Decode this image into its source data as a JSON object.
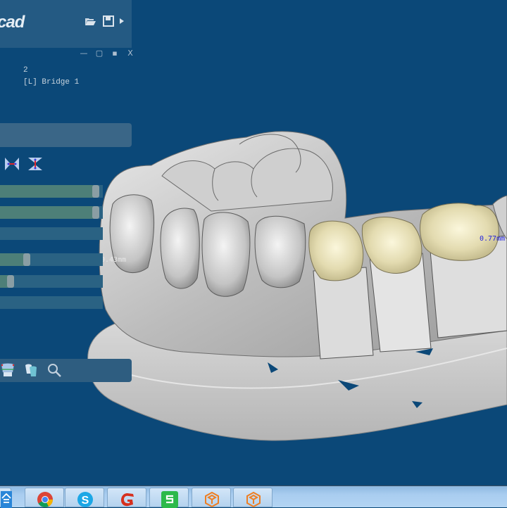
{
  "app": {
    "brand": "cad",
    "header_icons": [
      "folder-open-icon",
      "save-icon",
      "expand-arrow-icon"
    ],
    "window_controls": {
      "minimize": "—",
      "restore": "▢",
      "pin": "▪",
      "close": "X"
    }
  },
  "panel": {
    "info_line1": "2",
    "info_line2": "[L] Bridge 1",
    "tools": [
      {
        "name": "mesial-distal-contact-tool",
        "icon": "horizontal-contact-icon"
      },
      {
        "name": "occlusal-contact-tool",
        "icon": "vertical-contact-icon"
      }
    ],
    "sliders": [
      {
        "name": "slider-1",
        "value": 0.96
      },
      {
        "name": "slider-2",
        "value": 0.96
      },
      {
        "name": "slider-3",
        "value": 0.0
      },
      {
        "name": "slider-4",
        "value": 0.24
      },
      {
        "name": "slider-5",
        "value": 0.07
      },
      {
        "name": "slider-6",
        "value": 0.0
      }
    ],
    "bottom_tools": [
      {
        "name": "crown-margin-tool",
        "icon": "tooth-margin-icon"
      },
      {
        "name": "tooth-library-tool",
        "icon": "teeth-icon"
      },
      {
        "name": "zoom-tool",
        "icon": "magnifier-icon"
      }
    ]
  },
  "viewport": {
    "measurements": [
      {
        "label": "0.43mm",
        "color": "#e8e8e8"
      },
      {
        "label": "0.77mm",
        "color": "#2222dd"
      }
    ],
    "colors": {
      "background": "#0b4878",
      "stone_model": "#c9c9c9",
      "crown": "#e6dfb6"
    }
  },
  "taskbar": {
    "apps": [
      {
        "name": "qq-partial",
        "icon": "qq-icon"
      },
      {
        "name": "chrome",
        "icon": "chrome-icon"
      },
      {
        "name": "skype",
        "icon": "skype-icon"
      },
      {
        "name": "red-g-app",
        "icon": "red-g-icon"
      },
      {
        "name": "wps-spreadsheet",
        "icon": "wps-s-icon"
      },
      {
        "name": "exocad-1",
        "icon": "exocad-icon"
      },
      {
        "name": "exocad-2",
        "icon": "exocad-icon"
      }
    ]
  }
}
